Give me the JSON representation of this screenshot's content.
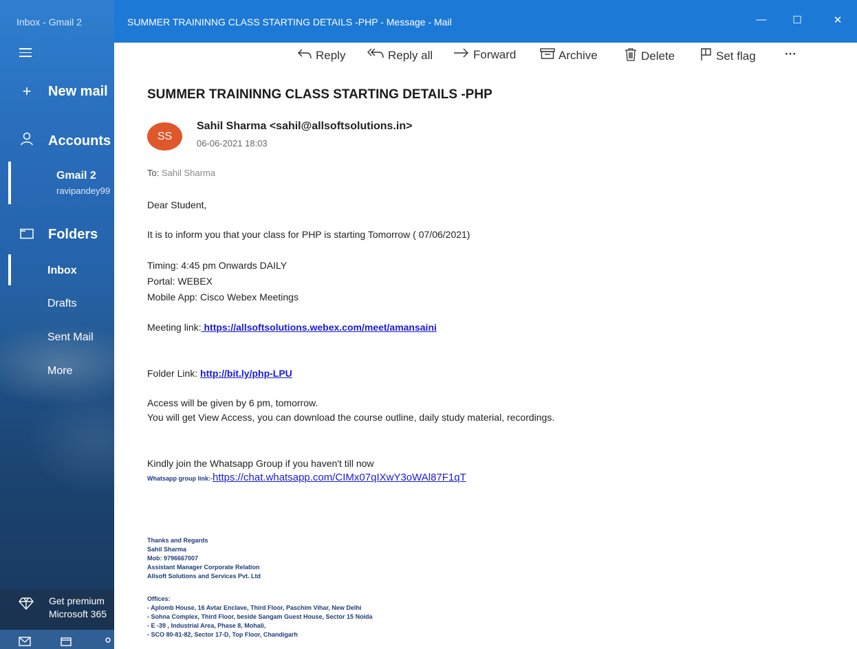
{
  "sidebar": {
    "window_title": "Inbox - Gmail 2",
    "new_mail": "New mail",
    "accounts": "Accounts",
    "account_name": "Gmail 2",
    "account_email": "ravipandey99",
    "folders": "Folders",
    "items": [
      "Inbox",
      "Drafts",
      "Sent Mail",
      "More"
    ],
    "premium_line1": "Get premium",
    "premium_line2": "Microsoft 365"
  },
  "titlebar": {
    "title": "SUMMER TRAININNG CLASS STARTING DETAILS -PHP - Message - Mail"
  },
  "toolbar": {
    "reply": "Reply",
    "reply_all": "Reply all",
    "forward": "Forward",
    "archive": "Archive",
    "delete": "Delete",
    "set_flag": "Set flag",
    "more": "···"
  },
  "message": {
    "subject": "SUMMER TRAININNG CLASS STARTING DETAILS -PHP",
    "avatar_initials": "SS",
    "sender": "Sahil Sharma <sahil@allsoftsolutions.in>",
    "date": "06-06-2021 18:03",
    "to_label": "To:",
    "to_value": "Sahil Sharma",
    "greeting": "Dear Student,",
    "inform": "It is to inform you that your class for PHP  is starting Tomorrow ( 07/06/2021)",
    "timing": "Timing: 4:45 pm Onwards DAILY",
    "portal": "Portal: WEBEX",
    "mobile_app": "Mobile App: Cisco Webex Meetings",
    "meeting_label": "Meeting link:",
    "meeting_url": " https://allsoftsolutions.webex.com/meet/amansaini",
    "folder_label": "Folder Link: ",
    "folder_url": "http://bit.ly/php-LPU",
    "access1": "Access will be given by 6 pm, tomorrow.",
    "access2": "You will get View Access, you can download the course outline, daily study material, recordings.",
    "whatsapp_join": "Kindly join the Whatsapp Group if you haven't till now",
    "whatsapp_label": "Whatsapp group link:-",
    "whatsapp_url": "https://chat.whatsapp.com/CIMx07qIXwY3oWAl87F1qT",
    "signature": [
      "Thanks and Regards",
      "Sahil Sharma",
      "Mob: 9796667007",
      "Assistant Manager Corporate Relation",
      "Allsoft Solutions and Services Pvt. Ltd"
    ],
    "offices_title": "Offices:",
    "offices": [
      "- Aplomb House, 16 Avtar Enclave, Third Floor, Paschim Vihar, New Delhi",
      "- Sohna Complex, Third Floor, beside Sangam Guest House, Sector 15 Noida",
      "-  E -39 , Industrial Area, Phase 8,  Mohali,",
      "- SCO 80-81-82, Sector 17-D, Top Floor, Chandigarh"
    ]
  }
}
